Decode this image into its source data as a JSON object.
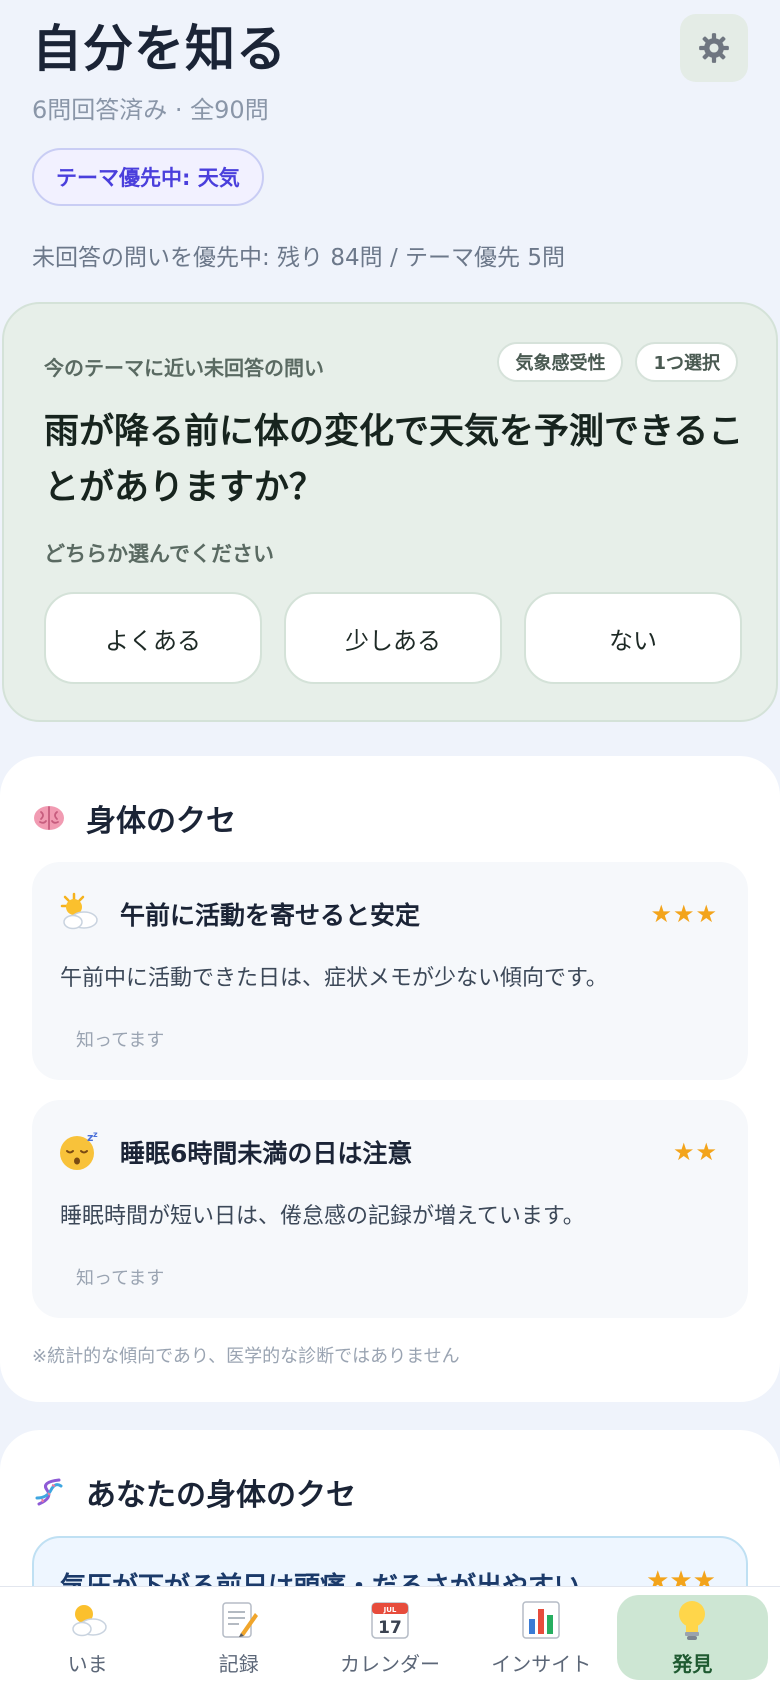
{
  "header": {
    "title": "自分を知る",
    "subtitle": "6問回答済み · 全90問"
  },
  "theme_chip": "テーマ優先中: 天気",
  "priority_note": "未回答の問いを優先中: 残り 84問 / テーマ優先 5問",
  "question_card": {
    "eyebrow": "今のテーマに近い未回答の問い",
    "tags": [
      "気象感受性",
      "1つ選択"
    ],
    "question": "雨が降る前に体の変化で天気を予測できることがありますか？",
    "hint": "どちらか選んでください",
    "options": [
      "よくある",
      "少しある",
      "ない"
    ]
  },
  "section_body_habits": {
    "title": "身体のクセ",
    "icon": "brain-icon",
    "insights": [
      {
        "icon": "sun-behind-cloud-icon",
        "title": "午前に活動を寄せると安定",
        "stars": "★★★",
        "rating": 3,
        "body": "午前中に活動できた日は、症状メモが少ない傾向です。",
        "know_label": "知ってます"
      },
      {
        "icon": "sleeping-face-icon",
        "title": "睡眠6時間未満の日は注意",
        "stars": "★★",
        "rating": 2,
        "body": "睡眠時間が短い日は、倦怠感の記録が増えています。",
        "know_label": "知ってます"
      }
    ],
    "disclaimer": "※統計的な傾向であり、医学的な診断ではありません"
  },
  "section_your_habits": {
    "title": "あなたの身体のクセ",
    "icon": "dna-icon",
    "highlight": {
      "title": "気圧が下がる前日は頭痛・だるさが出やすい",
      "stars": "★★★",
      "rating": 3
    }
  },
  "bottom_nav": [
    {
      "label": "いま",
      "icon": "sun-cloud-icon",
      "active": false
    },
    {
      "label": "記録",
      "icon": "memo-icon",
      "active": false
    },
    {
      "label": "カレンダー",
      "icon": "calendar-icon",
      "active": false
    },
    {
      "label": "インサイト",
      "icon": "bar-chart-icon",
      "active": false
    },
    {
      "label": "発見",
      "icon": "light-bulb-icon",
      "active": true
    }
  ],
  "calendar_icon_text": {
    "month": "JUL",
    "day": "17"
  },
  "colors": {
    "background": "#eff3fb",
    "accent_purple": "#4a3fdc",
    "question_card_bg": "#e7efe9",
    "star": "#f3a41b",
    "nav_active_bg": "#cde6d3"
  }
}
